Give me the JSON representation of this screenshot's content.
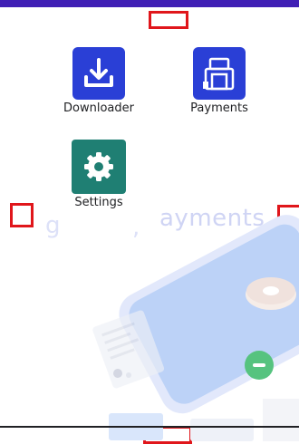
{
  "apps": [
    {
      "label": "Downloader",
      "icon": "download-icon",
      "color": "#2a3fd6"
    },
    {
      "label": "Payments",
      "icon": "payments-icon",
      "color": "#2a3fd6"
    },
    {
      "label": "Settings",
      "icon": "gear-icon",
      "color": "#1f7f73"
    }
  ],
  "background": {
    "word": "ayments"
  },
  "colors": {
    "status_bar": "#3f1fb5",
    "marker": "#e0161b"
  }
}
